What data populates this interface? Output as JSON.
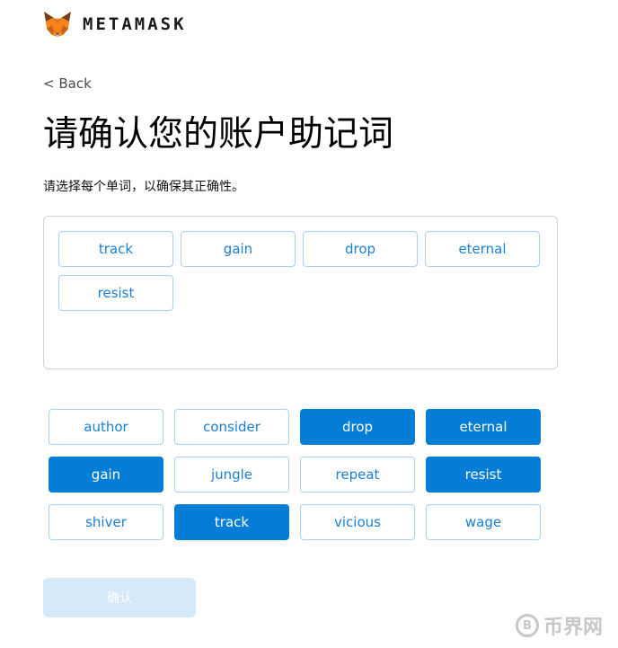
{
  "header": {
    "brand": "METAMASK",
    "logo": "metamask-fox-icon"
  },
  "nav": {
    "back_label": "< Back"
  },
  "page": {
    "title": "请确认您的账户助记词",
    "subtitle": "请选择每个单词，以确保其正确性。"
  },
  "selected_words": [
    "track",
    "gain",
    "drop",
    "eternal",
    "resist"
  ],
  "word_bank": [
    {
      "word": "author",
      "selected": false
    },
    {
      "word": "consider",
      "selected": false
    },
    {
      "word": "drop",
      "selected": true
    },
    {
      "word": "eternal",
      "selected": true
    },
    {
      "word": "gain",
      "selected": true
    },
    {
      "word": "jungle",
      "selected": false
    },
    {
      "word": "repeat",
      "selected": false
    },
    {
      "word": "resist",
      "selected": true
    },
    {
      "word": "shiver",
      "selected": false
    },
    {
      "word": "track",
      "selected": true
    },
    {
      "word": "vicious",
      "selected": false
    },
    {
      "word": "wage",
      "selected": false
    }
  ],
  "confirm_button": {
    "label": "确认",
    "enabled": false
  },
  "watermark": {
    "text": "币界网",
    "logo_glyph": "B"
  },
  "colors": {
    "accent": "#037dd6",
    "word_border": "#a9d2ef",
    "disabled_button": "#d6e9f8"
  }
}
